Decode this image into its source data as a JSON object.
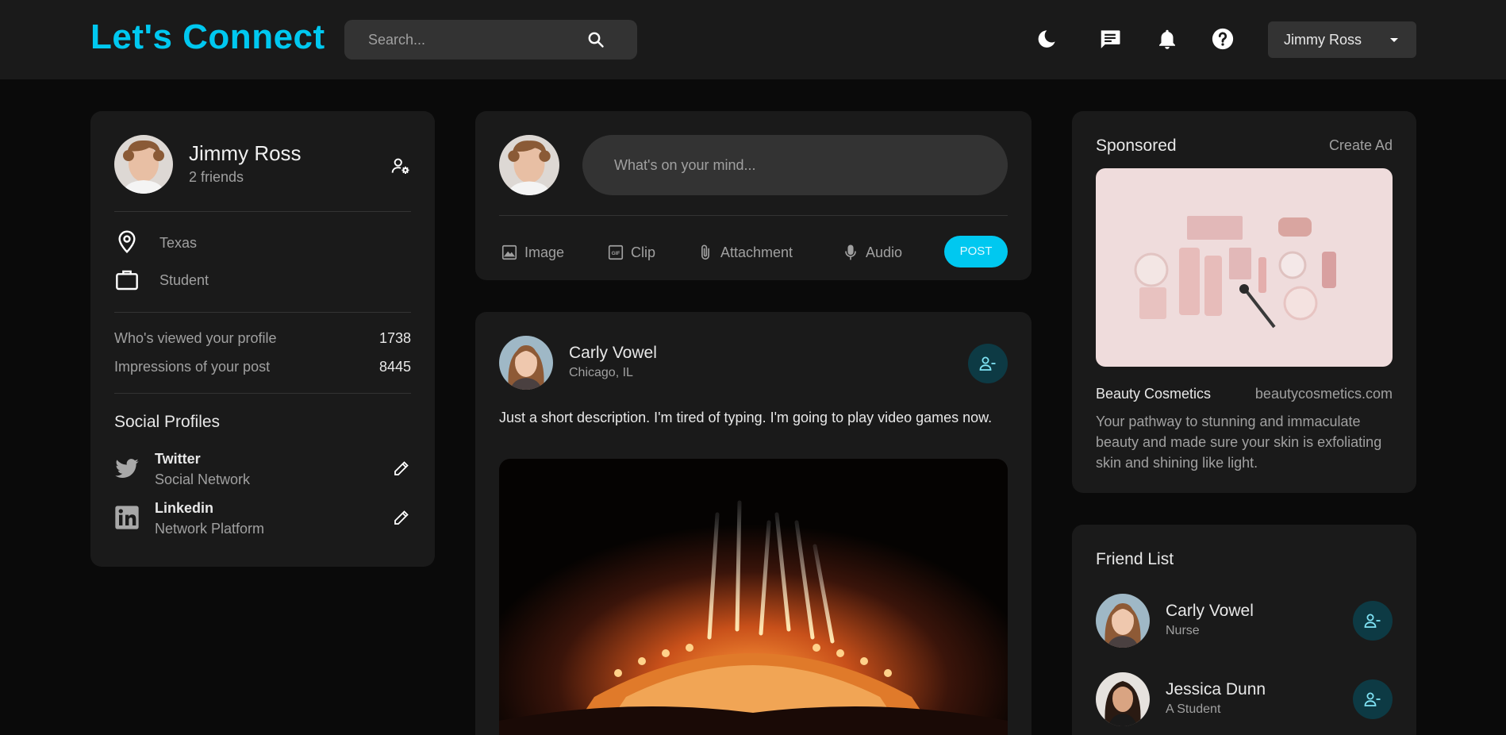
{
  "header": {
    "logo": "Let's Connect",
    "search_placeholder": "Search...",
    "icons": [
      "moon-icon",
      "chat-icon",
      "bell-icon",
      "help-icon"
    ],
    "user_menu": "Jimmy Ross"
  },
  "profile": {
    "name": "Jimmy Ross",
    "friends": "2 friends",
    "location": "Texas",
    "occupation": "Student",
    "stats": [
      {
        "label": "Who's viewed your profile",
        "value": "1738"
      },
      {
        "label": "Impressions of your post",
        "value": "8445"
      }
    ],
    "social_title": "Social Profiles",
    "social": [
      {
        "name": "Twitter",
        "sub": "Social Network"
      },
      {
        "name": "Linkedin",
        "sub": "Network Platform"
      }
    ]
  },
  "create_post": {
    "placeholder": "What's on your mind...",
    "actions": [
      "Image",
      "Clip",
      "Attachment",
      "Audio"
    ],
    "post_label": "POST"
  },
  "post": {
    "author": "Carly Vowel",
    "location": "Chicago, IL",
    "description": "Just a short description. I'm tired of typing. I'm going to play video games now."
  },
  "sponsored": {
    "title": "Sponsored",
    "create_ad": "Create Ad",
    "brand": "Beauty Cosmetics",
    "url": "beautycosmetics.com",
    "description": "Your pathway to stunning and immaculate beauty and made sure your skin is exfoliating skin and shining like light."
  },
  "friend_list": {
    "title": "Friend List",
    "friends": [
      {
        "name": "Carly Vowel",
        "role": "Nurse"
      },
      {
        "name": "Jessica Dunn",
        "role": "A Student"
      }
    ]
  },
  "colors": {
    "accent": "#00c8f0",
    "background": "#0a0a0a",
    "card": "#1a1a1a",
    "input": "#333333"
  }
}
